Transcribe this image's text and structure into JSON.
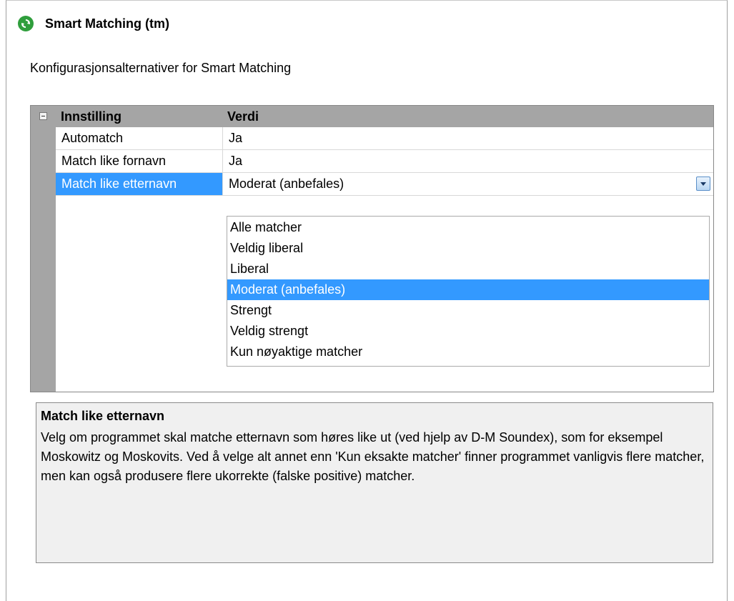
{
  "header": {
    "icon": "refresh-icon",
    "title": "Smart Matching (tm)"
  },
  "subtitle": "Konfigurasjonsalternativer for Smart Matching",
  "grid": {
    "columns": [
      "Innstilling",
      "Verdi"
    ],
    "rows": [
      {
        "name": "Automatch",
        "value": "Ja"
      },
      {
        "name": "Match like fornavn",
        "value": "Ja"
      },
      {
        "name": "Match like etternavn",
        "value": "Moderat (anbefales)"
      }
    ],
    "selected_row": 2
  },
  "dropdown": {
    "options": [
      "Alle matcher",
      "Veldig liberal",
      "Liberal",
      "Moderat (anbefales)",
      "Strengt",
      "Veldig strengt",
      "Kun nøyaktige matcher"
    ],
    "selected_index": 3
  },
  "description": {
    "title": "Match like etternavn",
    "text": "Velg om programmet skal matche etternavn som høres like ut (ved hjelp av D-M Soundex), som for eksempel Moskowitz og Moskovits. Ved å velge alt annet enn 'Kun eksakte matcher' finner programmet vanligvis flere matcher, men kan også produsere flere ukorrekte (falske positive) matcher."
  },
  "colors": {
    "selection": "#3399ff",
    "grid_header": "#a5a5a5",
    "description_bg": "#f0f0f0",
    "icon_green": "#2f9e3c"
  }
}
